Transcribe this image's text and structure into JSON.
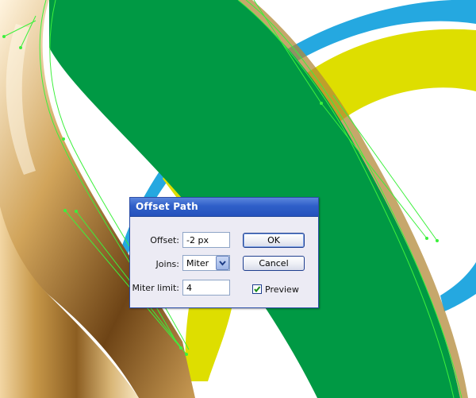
{
  "dialog": {
    "title": "Offset Path",
    "offset": {
      "label": "Offset:",
      "value": "-2 px"
    },
    "joins": {
      "label": "Joins:",
      "value": "Miter"
    },
    "miter_limit": {
      "label": "Miter limit:",
      "value": "4"
    },
    "ok_label": "OK",
    "cancel_label": "Cancel",
    "preview": {
      "label": "Preview",
      "checked": true
    }
  },
  "colors": {
    "green_ring": "#009944",
    "yellow_ring": "#dede00",
    "blue_ring": "#25a8e0",
    "gold_ring": "#b8842c",
    "path_guide": "#3cf03c",
    "dialog_title": "#2f5fc8"
  },
  "icons": [
    "chevron-down-icon",
    "checkmark-icon"
  ]
}
